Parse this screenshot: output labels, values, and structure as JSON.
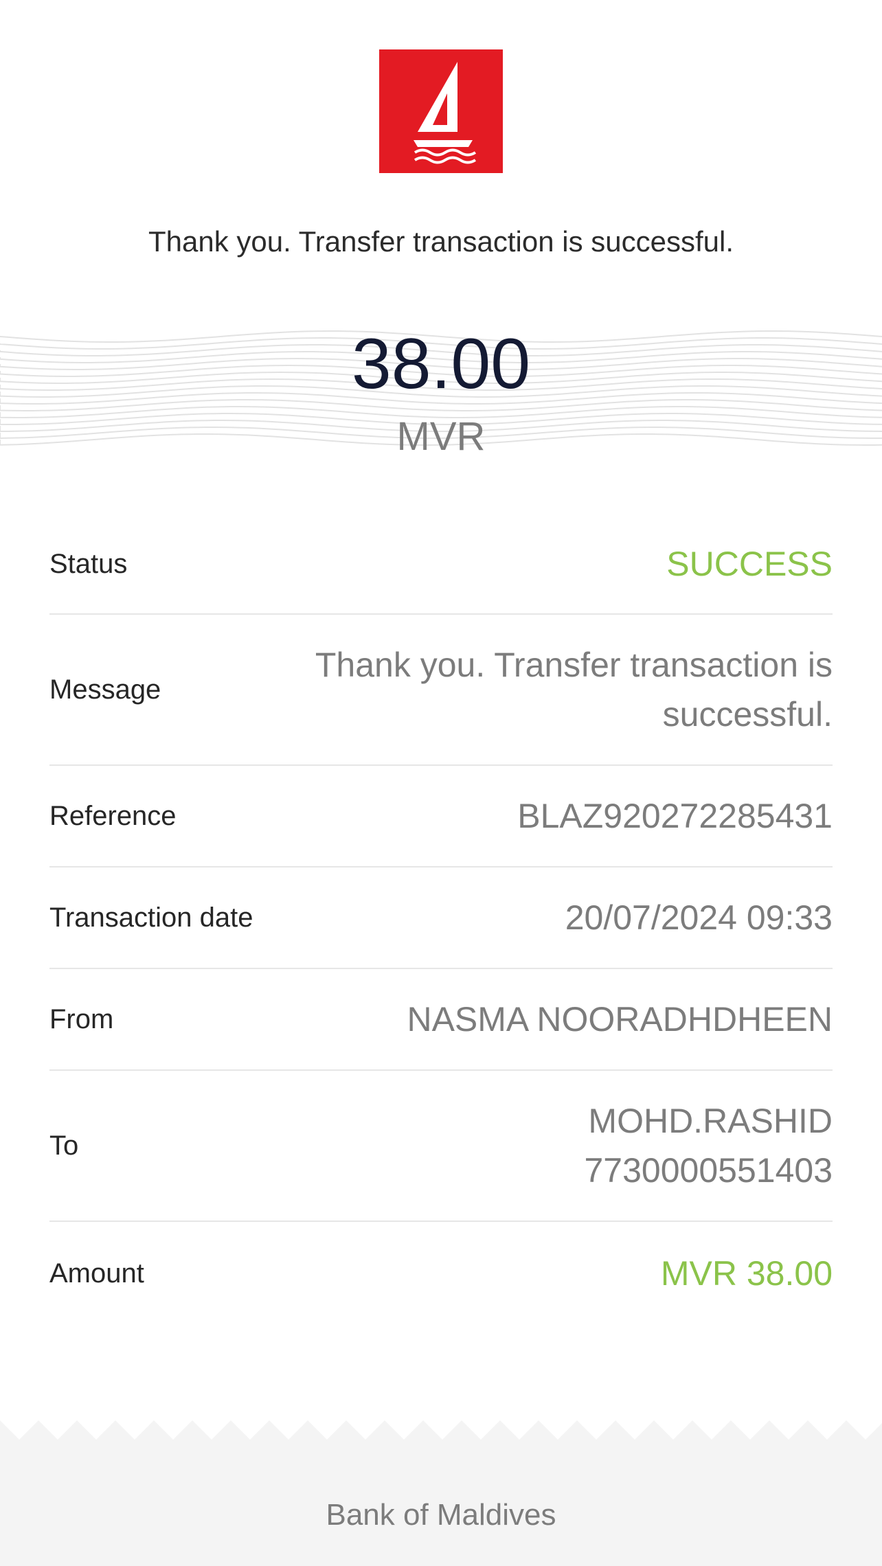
{
  "logo": {
    "icon": "sailboat-logo-icon",
    "color": "#e31b23"
  },
  "header": {
    "message": "Thank you. Transfer transaction is successful."
  },
  "summary": {
    "amount": "38.00",
    "currency": "MVR"
  },
  "details": {
    "status": {
      "label": "Status",
      "value": "SUCCESS"
    },
    "message": {
      "label": "Message",
      "value_line1": "Thank you. Transfer transaction is",
      "value_line2": "successful."
    },
    "reference": {
      "label": "Reference",
      "value": "BLAZ920272285431"
    },
    "transaction_date": {
      "label": "Transaction date",
      "value": "20/07/2024 09:33"
    },
    "from": {
      "label": "From",
      "value": "NASMA NOORADHDHEEN"
    },
    "to": {
      "label": "To",
      "value_line1": "MOHD.RASHID",
      "value_line2": "7730000551403"
    },
    "amount": {
      "label": "Amount",
      "value": "MVR 38.00"
    }
  },
  "footer": {
    "text": "Bank of Maldives"
  },
  "colors": {
    "success": "#8bc34a",
    "brand_red": "#e31b23",
    "amount_dark": "#141a33"
  }
}
